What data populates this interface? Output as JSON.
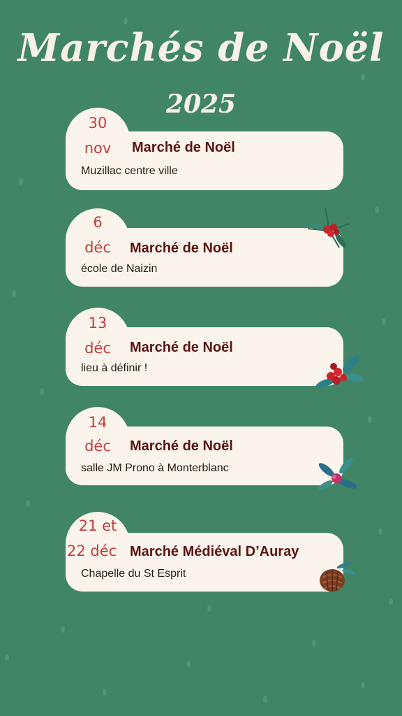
{
  "title": "Marchés de Noël",
  "year": "2025",
  "events": [
    {
      "date_line1": "30",
      "date_line2": "nov",
      "name": "Marché de Noël",
      "place": "Muzillac centre ville"
    },
    {
      "date_line1": "6",
      "date_line2": "déc",
      "name": "Marché de Noël",
      "place": "école de Naizin"
    },
    {
      "date_line1": "13",
      "date_line2": "déc",
      "name": "Marché de Noël",
      "place": "lieu à définir !"
    },
    {
      "date_line1": "14",
      "date_line2": "déc",
      "name": "Marché de Noël",
      "place": "salle JM Prono à Monterblanc"
    },
    {
      "date_line1": "21 et",
      "date_line2": "22 déc",
      "name": "Marché Médiéval D’Auray",
      "place": "Chapelle du St Esprit"
    }
  ],
  "colors": {
    "background": "#3f8566",
    "card": "#fbf4ec",
    "date": "#c1403d",
    "name": "#5a1414"
  },
  "decorations": [
    "holly-berries-icon",
    "holly-berries-icon",
    "holly-berries-icon",
    "pine-cone-icon"
  ]
}
